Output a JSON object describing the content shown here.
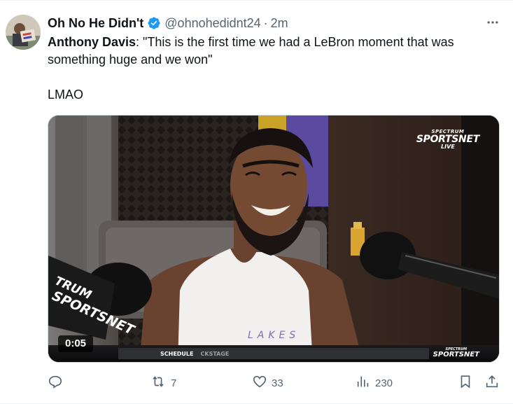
{
  "author": {
    "display_name": "Oh No He Didn't",
    "handle": "@ohnohedidnt24",
    "separator": "·",
    "time": "2m",
    "verified_icon": "verified-badge-icon",
    "verified_color": "#1d9bf0"
  },
  "tweet": {
    "speaker": "Anthony Davis",
    "quote": ": \"This is the first time we had a LeBron moment that was something huge and we won\"",
    "reaction": "LMAO"
  },
  "media": {
    "duration": "0:05",
    "watermark_top": "SPECTRUM",
    "watermark_main": "SPORTSNET",
    "watermark_live": "LIVE",
    "ticker_left": "SCHEDULE",
    "ticker_right": "CKSTAGE",
    "ticker_logo_top": "SPECTRUM",
    "ticker_logo_main": "SPORTSNET",
    "mic_flag_text": "TRUM SPORTSNET",
    "jersey_text": "LAKERS"
  },
  "actions": {
    "reply_count": "",
    "retweet_count": "7",
    "like_count": "33",
    "views_count": "230"
  },
  "colors": {
    "text_primary": "#0f1419",
    "text_secondary": "#536471",
    "border": "#cfd9de"
  }
}
